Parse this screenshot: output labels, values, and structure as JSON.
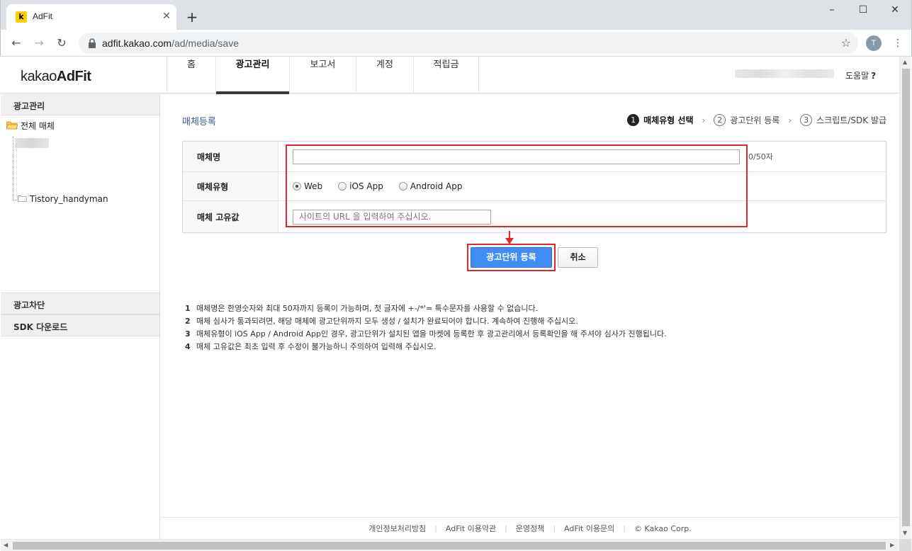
{
  "browser": {
    "tab_title": "AdFit",
    "tab_favicon": "k",
    "tab_close": "✕",
    "new_tab": "+",
    "url_host": "adfit.kakao.com",
    "url_path": "/ad/media/save",
    "profile_initial": "T"
  },
  "header": {
    "logo_light": "kakao",
    "logo_bold": "AdFit",
    "nav": [
      {
        "label": "홈",
        "active": false
      },
      {
        "label": "광고관리",
        "active": true
      },
      {
        "label": "보고서",
        "active": false
      },
      {
        "label": "계정",
        "active": false
      },
      {
        "label": "적립금",
        "active": false
      }
    ],
    "help_label": "도움말",
    "help_icon": "?"
  },
  "sidebar": {
    "section_title": "광고관리",
    "tree_root": "전체 매체",
    "tree_child": "Tistory_handyman",
    "groups": [
      "광고차단",
      "SDK 다운로드"
    ]
  },
  "main": {
    "title": "매체등록",
    "steps": [
      {
        "num": "1",
        "label": "매체유형 선택",
        "active": true
      },
      {
        "num": "2",
        "label": "광고단위 등록",
        "active": false
      },
      {
        "num": "3",
        "label": "스크립트/SDK 발급",
        "active": false
      }
    ],
    "form": {
      "name_label": "매체명",
      "name_value": "",
      "name_counter": "0/50자",
      "type_label": "매체유형",
      "type_options": [
        {
          "label": "Web",
          "checked": true
        },
        {
          "label": "iOS App",
          "checked": false
        },
        {
          "label": "Android App",
          "checked": false
        }
      ],
      "id_label": "매체 고유값",
      "id_placeholder": "사이트의 URL 을 입력하여 주십시오."
    },
    "submit_label": "광고단위 등록",
    "cancel_label": "취소",
    "notes": [
      {
        "num": "1",
        "text": "매체명은 한영숫자와 최대 50자까지 등록이 가능하며, 첫 글자에 +-/*'= 특수문자를 사용할 수 없습니다."
      },
      {
        "num": "2",
        "text": "매체 심사가 통과되려면, 해당 매체에 광고단위까지 모두 생성 / 설치가 완료되어야 합니다. 계속하여 진행해 주십시오."
      },
      {
        "num": "3",
        "text": "매체유형이 iOS App / Android App인 경우, 광고단위가 설치된 앱을 마켓에 등록한 후 광고관리에서 등록확인을 해 주셔야 심사가 진행됩니다."
      },
      {
        "num": "4",
        "text": "매체 고유값은 최초 입력 후 수정이 불가능하니 주의하여 입력해 주십시오."
      }
    ]
  },
  "footer": {
    "links": [
      "개인정보처리방침",
      "AdFit 이용약관",
      "운영정책",
      "AdFit 이용문의"
    ],
    "copyright": "© Kakao Corp."
  },
  "colors": {
    "accent_blue": "#3f8df5",
    "highlight_red": "#e0262e",
    "title_blue": "#3b5c8f",
    "brand_yellow": "#ffcd00"
  }
}
